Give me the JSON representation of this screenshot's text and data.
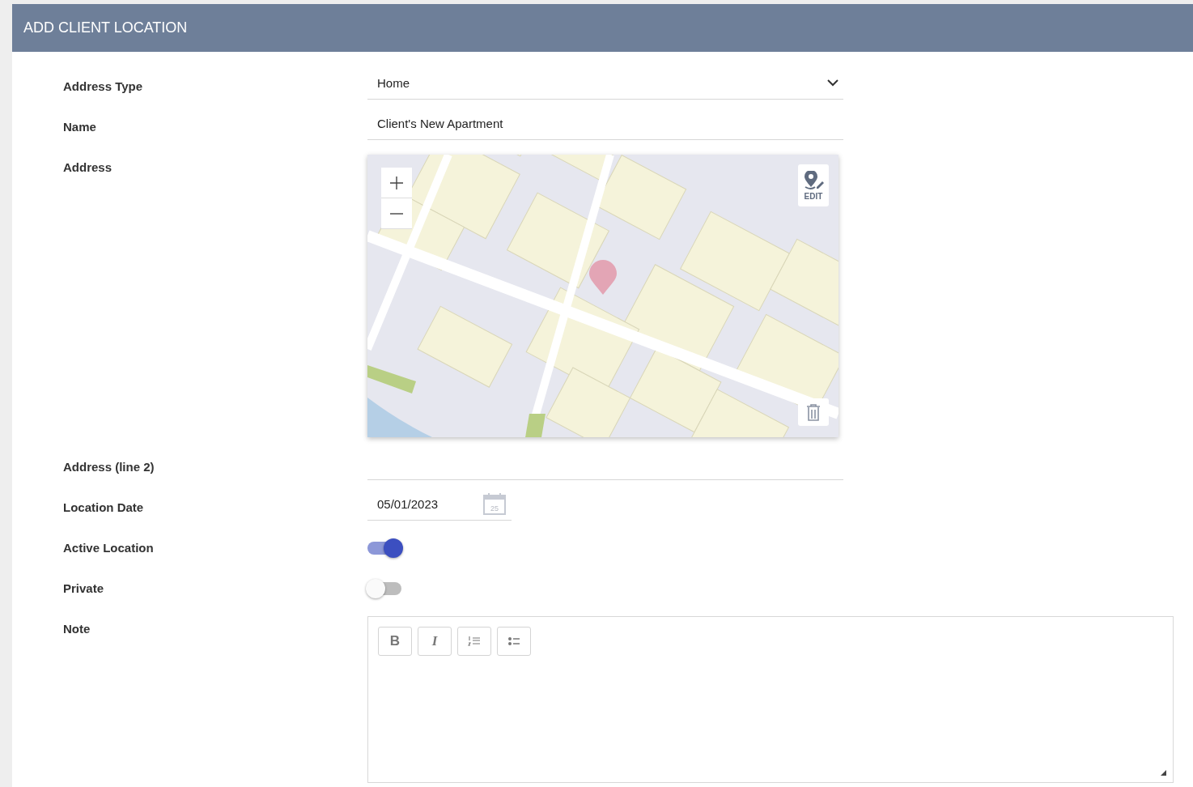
{
  "title": "ADD CLIENT LOCATION",
  "fields": [
    {
      "kind": "select",
      "label": "Address Type",
      "value": "Home"
    },
    {
      "kind": "text",
      "label": "Name",
      "value": "Client's New Apartment"
    },
    {
      "kind": "map",
      "label": "Address",
      "edit_label": "EDIT"
    },
    {
      "kind": "text",
      "label": "Address (line 2)"
    },
    {
      "kind": "date",
      "label": "Location Date",
      "value": "05/01/2023",
      "calendar_day": "25"
    },
    {
      "kind": "toggle",
      "label": "Active Location",
      "on": true
    },
    {
      "kind": "toggle",
      "label": "Private",
      "on": false
    },
    {
      "kind": "editor",
      "label": "Note",
      "tools": [
        {
          "kind": "bold",
          "label": "B"
        },
        {
          "kind": "italic",
          "label": "I"
        },
        {
          "kind": "numbered"
        },
        {
          "kind": "bulleted"
        }
      ]
    }
  ]
}
